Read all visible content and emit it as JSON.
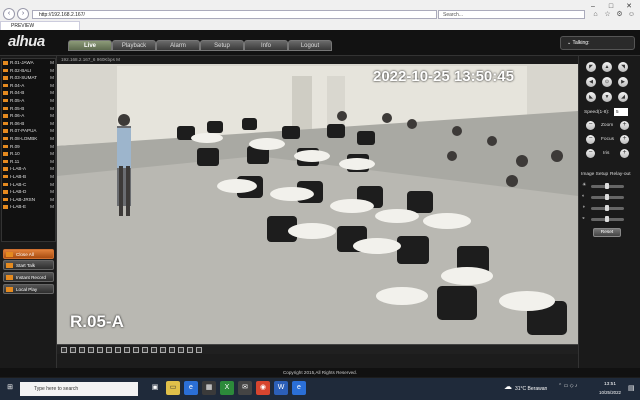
{
  "browser": {
    "url": "http://192.168.2.167/",
    "search_placeholder": "Search...",
    "tab_title": "PREVIEW"
  },
  "app": {
    "logo": "alhua",
    "nav_tabs": [
      {
        "label": "Live",
        "active": true
      },
      {
        "label": "Playback"
      },
      {
        "label": "Alarm"
      },
      {
        "label": "Setup"
      },
      {
        "label": "Info"
      },
      {
        "label": "Logout"
      }
    ],
    "talking_label": "Talking:"
  },
  "cameras": [
    "R.01-JAWA",
    "R.02-BALI",
    "R.03-SUMAT",
    "R.04-A",
    "R.04-B",
    "R.05-A",
    "R.05-B",
    "R.06-A",
    "R.06-B",
    "R.07-PAPUA",
    "R.08-LOMBK",
    "R.09",
    "R.10",
    "R.11",
    "I-LAB-A",
    "I-LAB-B",
    "I-LAB-C",
    "I-LAB-D",
    "I-LAB-JRSN",
    "I-LAB-E"
  ],
  "left_buttons": {
    "close_all": "Close All",
    "start_talk": "Start Talk",
    "instant_record": "Instant Record",
    "local_play": "Local Play"
  },
  "video": {
    "info": "192.168.2.167_6 960Kbps M",
    "timestamp": "2022-10-25 13:50:45",
    "channel_name": "R.05-A"
  },
  "ptz": {
    "speed_label": "Speed(1-8):",
    "speed_value": "5",
    "zoom": "Zoom",
    "focus": "Focus",
    "iris": "Iris"
  },
  "image_setup": {
    "tab1": "Image Setup",
    "tab2": "Relay-out",
    "reset": "Reset"
  },
  "footer": {
    "copyright": "Copyright 2015,All Rights Reserved."
  },
  "taskbar": {
    "search_placeholder": "Type here to search",
    "weather": "31°C  Berawan",
    "time": "13:51",
    "date": "10/25/2022"
  }
}
